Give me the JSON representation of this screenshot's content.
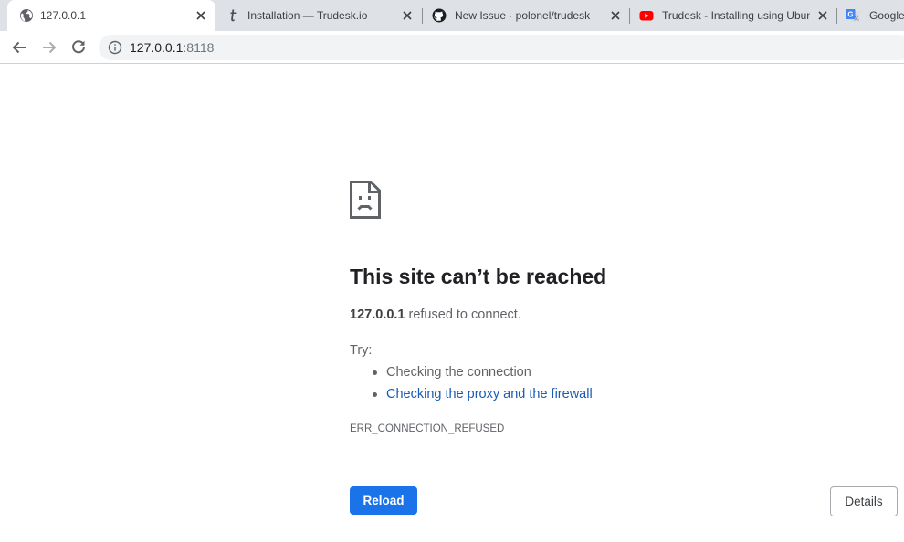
{
  "tabs": [
    {
      "title": "127.0.0.1",
      "icon": "globe-icon",
      "active": true
    },
    {
      "title": "Installation — Trudesk.io",
      "icon": "trudesk-logo-icon",
      "active": false
    },
    {
      "title": "New Issue · polonel/trudesk",
      "icon": "github-icon",
      "active": false
    },
    {
      "title": "Trudesk - Installing using Ubun",
      "icon": "youtube-icon",
      "active": false
    },
    {
      "title": "Google",
      "icon": "google-translate-icon",
      "active": false
    }
  ],
  "toolbar": {
    "back_icon": "back-arrow-icon",
    "forward_icon": "forward-arrow-icon",
    "reload_icon": "reload-icon",
    "site_info_icon": "info-icon",
    "url_host": "127.0.0.1",
    "url_port": ":8118"
  },
  "error": {
    "icon": "sad-page-icon",
    "title": "This site can’t be reached",
    "host": "127.0.0.1",
    "summary_rest": " refused to connect.",
    "try_label": "Try:",
    "suggestions": [
      {
        "text": "Checking the connection",
        "link": false
      },
      {
        "text": "Checking the proxy and the firewall",
        "link": true
      }
    ],
    "code": "ERR_CONNECTION_REFUSED",
    "reload_label": "Reload",
    "details_label": "Details"
  },
  "colors": {
    "tabstrip": "#dee1e6",
    "accent": "#1a73e8",
    "link": "#1a5bb5",
    "text": "#202124",
    "secondary_text": "#5f6368"
  }
}
